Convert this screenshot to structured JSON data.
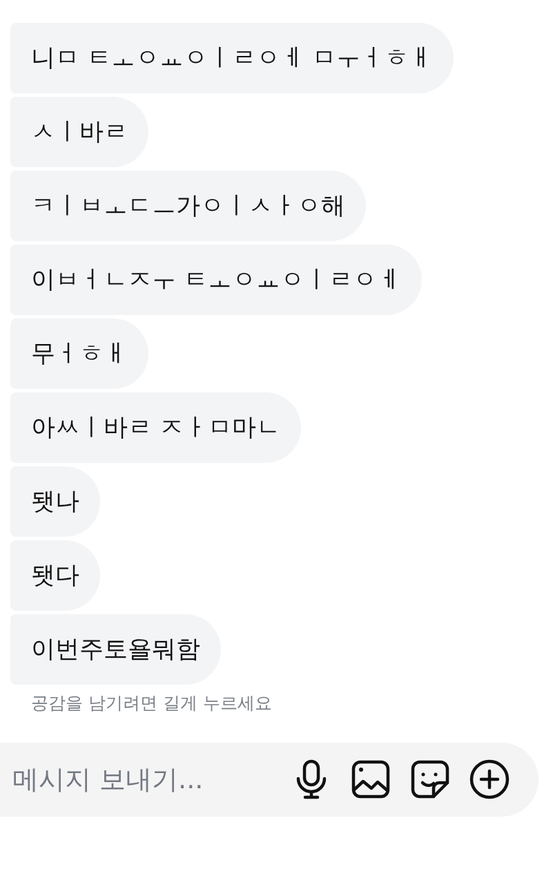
{
  "messages": [
    {
      "text": "니ㅁ ㅌㅗㅇㅛㅇㅣㄹㅇㅔ ㅁㅜㅓㅎㅐ"
    },
    {
      "text": "ㅅㅣ바ㄹ"
    },
    {
      "text": "ㅋㅣㅂㅗㄷㅡ가ㅇㅣㅅㅏㅇ해"
    },
    {
      "text": "이ㅂㅓㄴㅈㅜ ㅌㅗㅇㅛㅇㅣㄹㅇㅔ"
    },
    {
      "text": "무ㅓㅎㅐ"
    },
    {
      "text": "아ㅆㅣ바ㄹ ㅈㅏㅁ마ㄴ"
    },
    {
      "text": "됏나"
    },
    {
      "text": "됏다"
    },
    {
      "text": "이번주토욜뭐함"
    }
  ],
  "reaction_hint": "공감을 남기려면 길게 누르세요",
  "composer": {
    "placeholder": "메시지 보내기..."
  }
}
